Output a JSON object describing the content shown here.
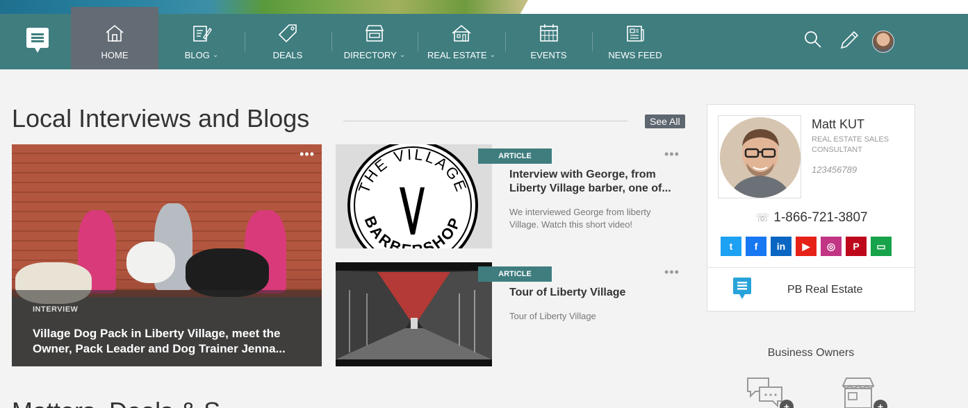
{
  "nav": {
    "items": [
      {
        "label": "HOME",
        "icon": "home-icon",
        "dropdown": false,
        "active": true
      },
      {
        "label": "BLOG",
        "icon": "blog-icon",
        "dropdown": true,
        "active": false
      },
      {
        "label": "DEALS",
        "icon": "tag-icon",
        "dropdown": false,
        "active": false
      },
      {
        "label": "DIRECTORY",
        "icon": "storefront-icon",
        "dropdown": true,
        "active": false
      },
      {
        "label": "REAL ESTATE",
        "icon": "house-icon",
        "dropdown": true,
        "active": false
      },
      {
        "label": "EVENTS",
        "icon": "calendar-icon",
        "dropdown": false,
        "active": false
      },
      {
        "label": "NEWS FEED",
        "icon": "newspaper-icon",
        "dropdown": false,
        "active": false
      }
    ],
    "chevron": "⌄",
    "right_icons": [
      "search-icon",
      "pencil-icon",
      "avatar"
    ]
  },
  "section": {
    "title": "Local Interviews and Blogs",
    "see_all": "See All"
  },
  "featured": {
    "kicker": "INTERVIEW",
    "headline": "Village Dog Pack in Liberty Village, meet the Owner, Pack Leader and Dog Trainer Jenna...",
    "more": "•••"
  },
  "articles": [
    {
      "badge": "ARTICLE",
      "title": "Interview with George, from Liberty Village barber, one of...",
      "desc": "We interviewed George from liberty Village. Watch this short video!",
      "more": "•••",
      "thumb_text_top": "THE VILLAGE",
      "thumb_text_bottom": "BARBERSHOP"
    },
    {
      "badge": "ARTICLE",
      "title": "Tour of Liberty Village",
      "desc": "Tour of Liberty Village",
      "more": "•••"
    }
  ],
  "profile": {
    "name": "Matt KUT",
    "role": "REAL ESTATE SALES CONSULTANT",
    "license": "123456789",
    "phone": "1-866-721-3807",
    "phone_icon": "☏",
    "social": [
      {
        "name": "twitter",
        "glyph": "t",
        "color": "#1da1f2"
      },
      {
        "name": "facebook",
        "glyph": "f",
        "color": "#1877f2"
      },
      {
        "name": "linkedin",
        "glyph": "in",
        "color": "#0a66c2"
      },
      {
        "name": "youtube",
        "glyph": "▶",
        "color": "#e62117"
      },
      {
        "name": "instagram",
        "glyph": "◎",
        "color": "#c13584"
      },
      {
        "name": "pinterest",
        "glyph": "P",
        "color": "#bd081c"
      },
      {
        "name": "website",
        "glyph": "▭",
        "color": "#16a34a"
      }
    ],
    "brand": "PB Real Estate"
  },
  "business": {
    "title": "Business Owners",
    "plus": "+"
  },
  "next_section": {
    "title": "Matters, Deals & S..."
  },
  "colors": {
    "nav_bg": "#3f7d7f",
    "nav_active": "#636b74",
    "badge": "#3f7d7f",
    "logo_blue": "#27a3d9"
  }
}
